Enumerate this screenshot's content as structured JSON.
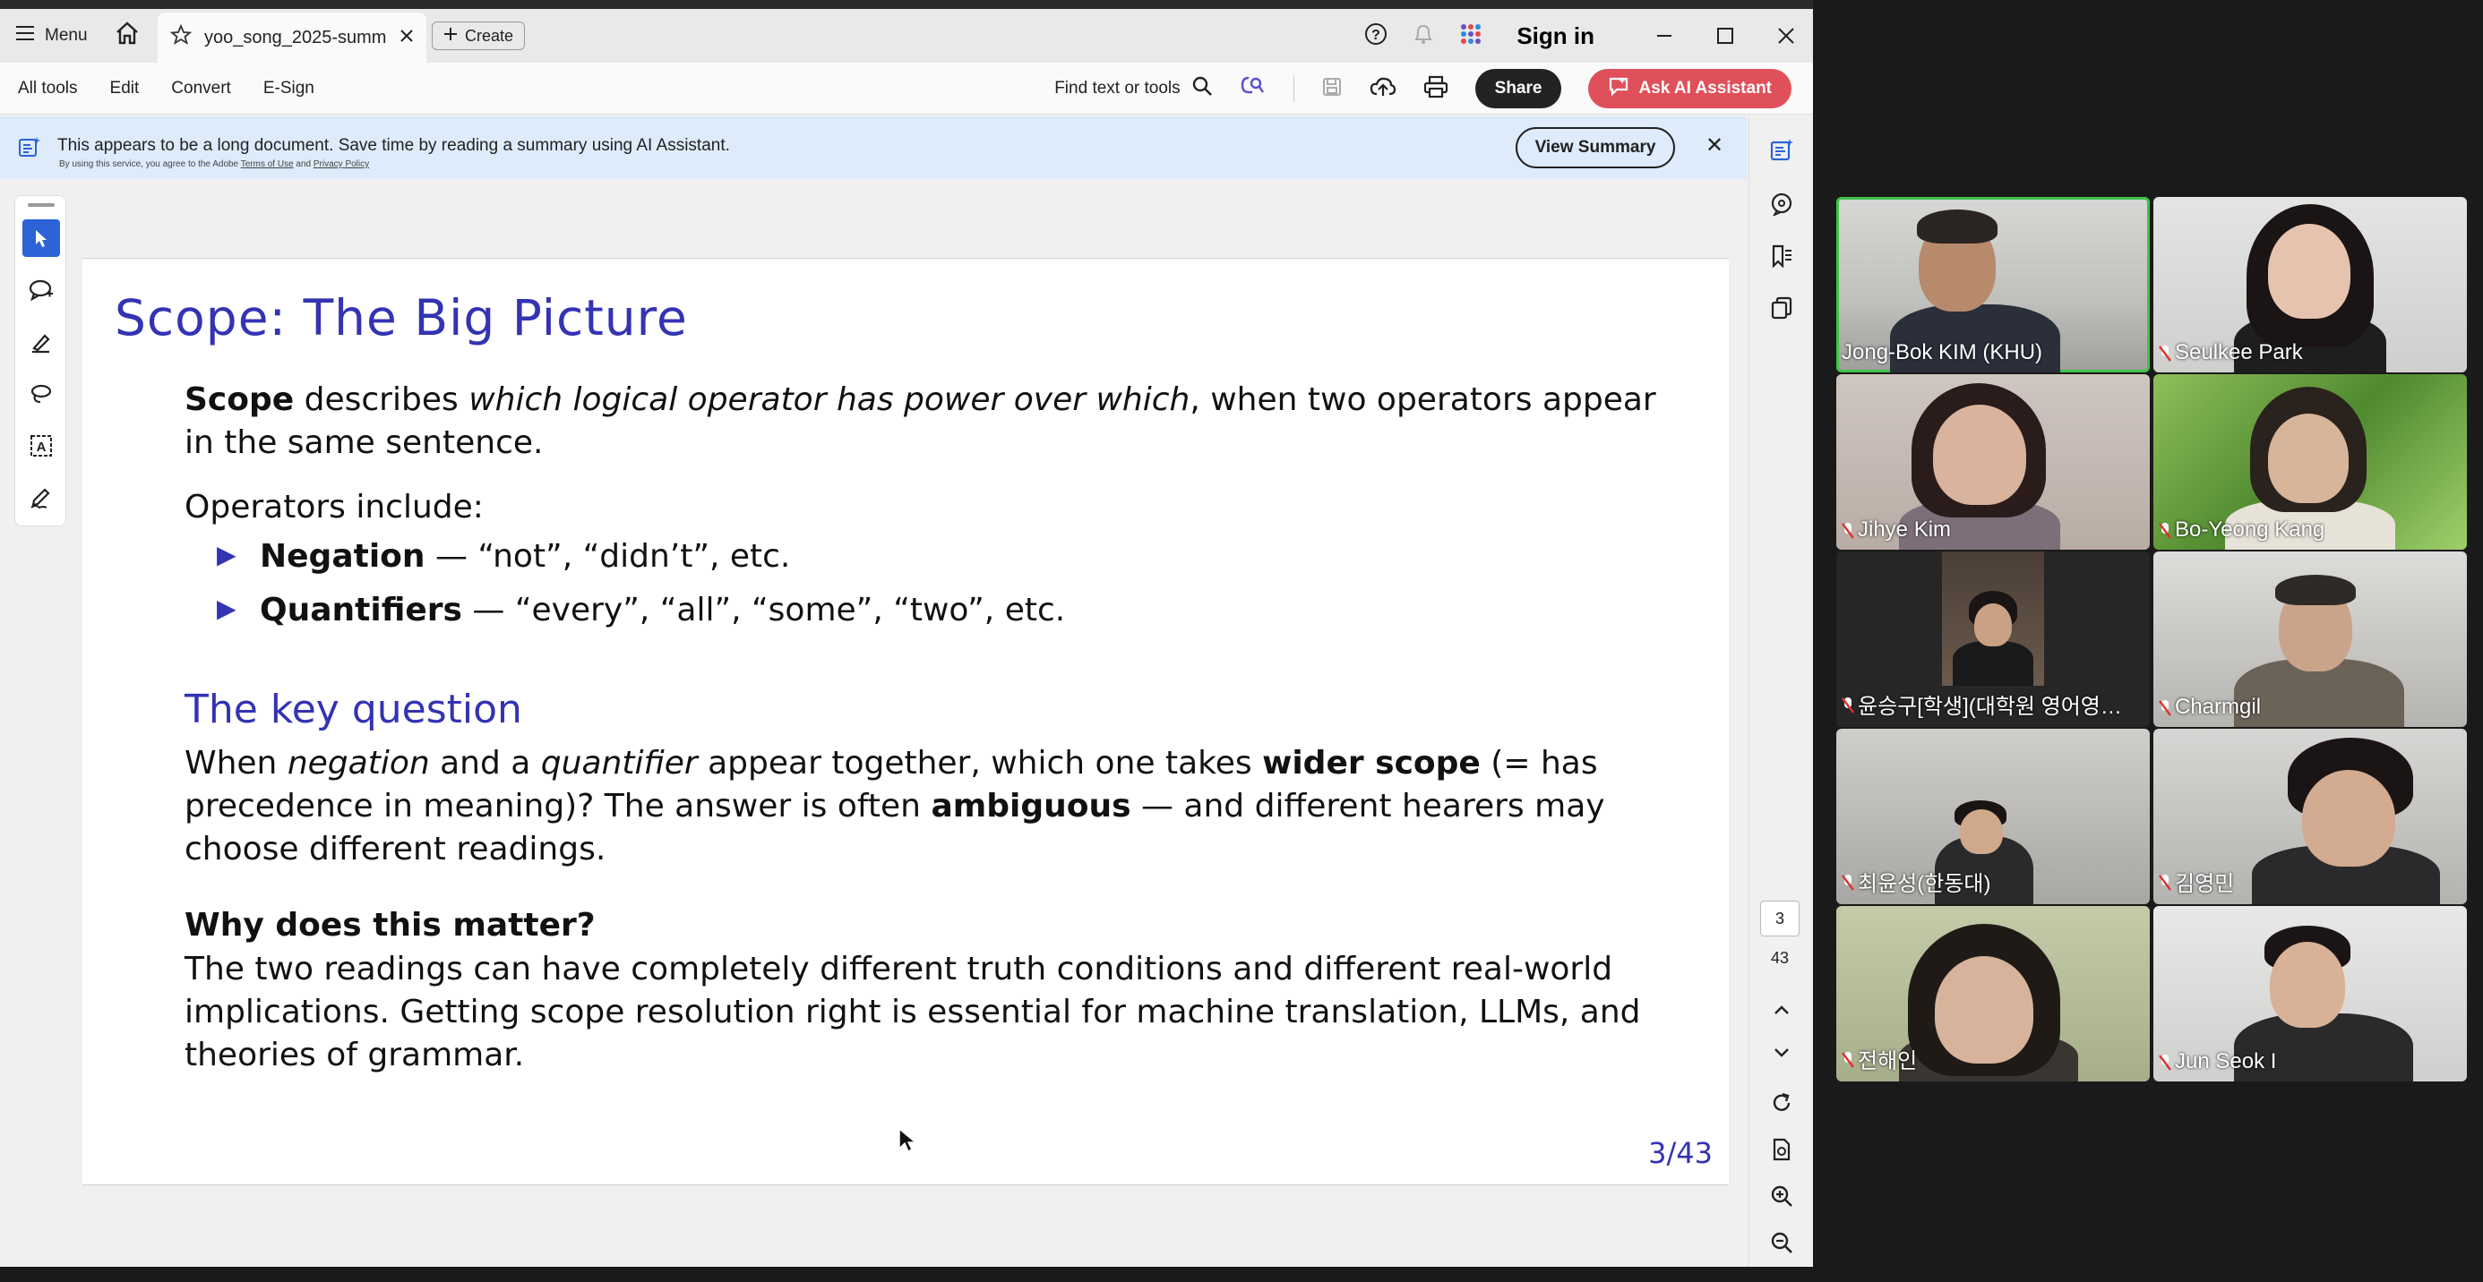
{
  "titlebar": {
    "menu_label": "Menu",
    "tab_title": "yoo_song_2025-summa...",
    "create_label": "Create",
    "sign_in": "Sign in"
  },
  "toolbar": {
    "menu_items": [
      "All tools",
      "Edit",
      "Convert",
      "E-Sign"
    ],
    "find_label": "Find text or tools",
    "share_label": "Share",
    "ai_label": "Ask AI Assistant"
  },
  "banner": {
    "message": "This appears to be a long document. Save time by reading a summary using AI Assistant.",
    "sub_prefix": "By using this service, you agree to the Adobe",
    "terms": "Terms of Use",
    "and": "and",
    "privacy": "Privacy Policy",
    "view_summary": "View Summary"
  },
  "slide": {
    "title": "Scope:  The Big Picture",
    "p1_bold": "Scope",
    "p1_mid": " describes ",
    "p1_ital": "which logical operator has power over which",
    "p1_end": ", when two operators appear in the same sentence.",
    "ops_intro": "Operators include:",
    "b1_bold": "Negation",
    "b1_rest": " — “not”, “didn’t”, etc.",
    "b2_bold": "Quantifiers",
    "b2_rest": " — “every”, “all”, “some”, “two”, etc.",
    "key_heading": "The key question",
    "k_a": "When ",
    "k_neg": "negation",
    "k_b": " and a ",
    "k_quant": "quantifier",
    "k_c": " appear together, which one takes ",
    "k_wider": "wider scope",
    "k_d": " (= has precedence in meaning)? The answer is often ",
    "k_amb": "ambiguous",
    "k_e": " — and different hearers may choose different readings.",
    "why_heading": "Why does this matter?",
    "why_text": "The two readings can have completely different truth conditions and different real-world implications. Getting scope resolution right is essential for machine translation, LLMs, and theories of grammar.",
    "page_label": "3/43"
  },
  "nav": {
    "current_page": "3",
    "total_pages": "43"
  },
  "participants": [
    {
      "name": "Jong-Bok KIM (KHU)",
      "muted": false
    },
    {
      "name": "Seulkee Park",
      "muted": true
    },
    {
      "name": "Jihye Kim",
      "muted": true
    },
    {
      "name": "Bo-Yeong Kang",
      "muted": true
    },
    {
      "name": "윤승구[학생](대학원 영어영…",
      "muted": true
    },
    {
      "name": "Charmgil",
      "muted": true
    },
    {
      "name": "최윤성(한동대)",
      "muted": true
    },
    {
      "name": "김영민",
      "muted": true
    },
    {
      "name": "전해인",
      "muted": true
    },
    {
      "name": "Jun Seok I",
      "muted": true
    }
  ],
  "colors": {
    "beamer_blue": "#3333b3",
    "ai_button": "#e0505a",
    "select_tool": "#2c63d6",
    "active_speaker": "#3fc34a",
    "muted_icon": "#e03030"
  }
}
